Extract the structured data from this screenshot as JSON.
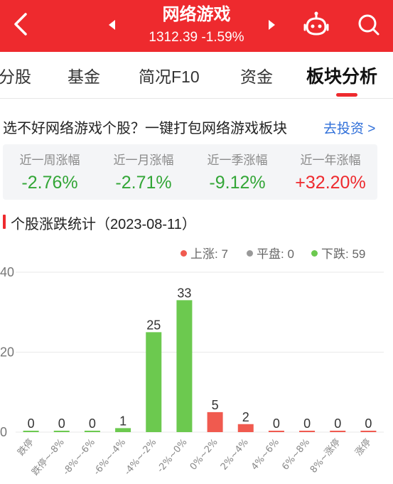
{
  "header": {
    "title": "网络游戏",
    "subtitle": "1312.39 -1.59%",
    "bg_color": "#ee2a2e"
  },
  "icons": {
    "back": "chevron-left-icon",
    "prev": "triangle-left-icon",
    "next": "triangle-right-icon",
    "robot": "robot-icon",
    "search": "search-icon"
  },
  "tabs": [
    {
      "label": "分股"
    },
    {
      "label": "基金"
    },
    {
      "label": "简况F10"
    },
    {
      "label": "资金"
    },
    {
      "label": "板块分析",
      "active": true
    }
  ],
  "promo": {
    "text": "选不好网络游戏个股？一键打包网络游戏板块",
    "link": "去投资 >"
  },
  "stats": [
    {
      "label": "近一周涨幅",
      "value": "-2.76%",
      "trend": "down"
    },
    {
      "label": "近一月涨幅",
      "value": "-2.71%",
      "trend": "down"
    },
    {
      "label": "近一季涨幅",
      "value": "-9.12%",
      "trend": "down"
    },
    {
      "label": "近一年涨幅",
      "value": "+32.20%",
      "trend": "up"
    }
  ],
  "section": {
    "title": "个股涨跌统计（2023-08-11）"
  },
  "legend": [
    {
      "label": "上涨: 7",
      "color": "#f05a4f"
    },
    {
      "label": "平盘: 0",
      "color": "#999999"
    },
    {
      "label": "下跌: 59",
      "color": "#6cc94f"
    }
  ],
  "chart_data": {
    "type": "bar",
    "categories": [
      "跌停",
      "跌停~-8%",
      "-8%~-6%",
      "-6%~-4%",
      "-4%~-2%",
      "-2%~0%",
      "0%~2%",
      "2%~4%",
      "4%~6%",
      "6%~8%",
      "8%~涨停",
      "涨停"
    ],
    "values": [
      0,
      0,
      0,
      1,
      25,
      33,
      5,
      2,
      0,
      0,
      0,
      0
    ],
    "colors": [
      "#6cc94f",
      "#6cc94f",
      "#6cc94f",
      "#6cc94f",
      "#6cc94f",
      "#6cc94f",
      "#f05a4f",
      "#f05a4f",
      "#f05a4f",
      "#f05a4f",
      "#f05a4f",
      "#f05a4f"
    ],
    "y_ticks": [
      "40",
      "20",
      "0"
    ],
    "y_tick_values": [
      40,
      20,
      0
    ],
    "ylim": [
      0,
      40
    ],
    "grid": true
  }
}
